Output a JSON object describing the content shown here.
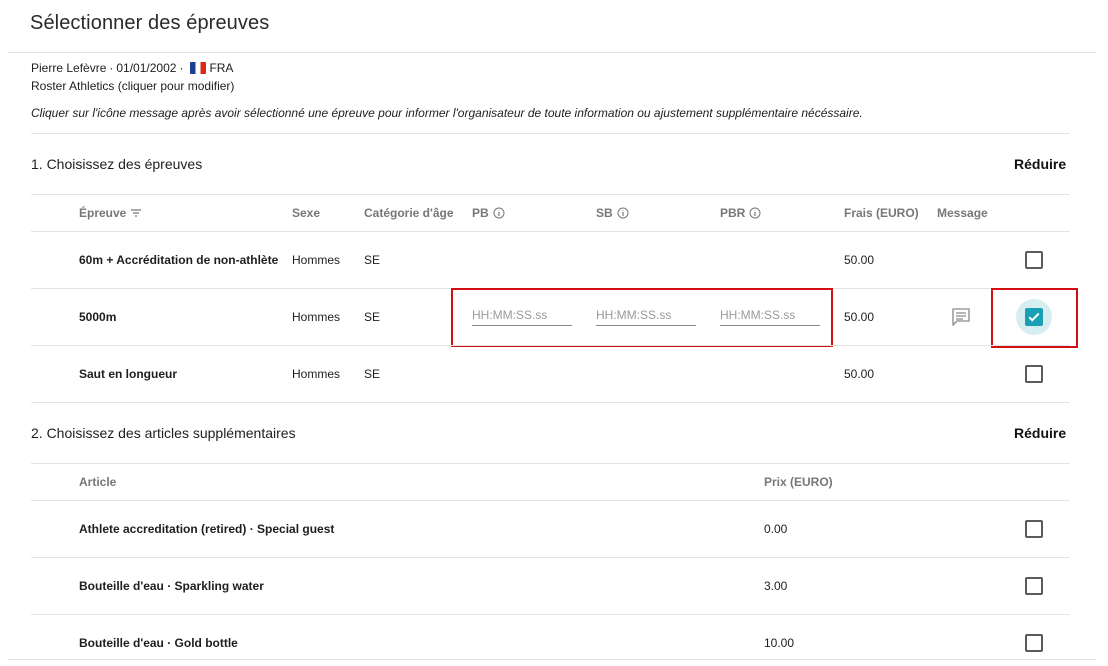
{
  "header": {
    "title": "Sélectionner des épreuves"
  },
  "athlete": {
    "name": "Pierre Lefèvre",
    "dob": "01/01/2002",
    "separator": "·",
    "country": "FRA",
    "club": "Roster Athletics (cliquer pour modifier)"
  },
  "info_text": "Cliquer sur l'icône message après avoir sélectionné une épreuve pour informer l'organisateur de toute information ou ajustement supplémentaire nécéssaire.",
  "events_section": {
    "title": "1. Choisissez des épreuves",
    "collapse_label": "Réduire",
    "columns": {
      "event": "Épreuve",
      "sex": "Sexe",
      "age": "Catégorie d'âge",
      "pb": "PB",
      "sb": "SB",
      "pbr": "PBR",
      "fee": "Frais (EURO)",
      "message": "Message"
    },
    "rows": [
      {
        "event": "60m + Accréditation de non-athlète",
        "sex": "Hommes",
        "age": "SE",
        "fee": "50.00",
        "checked": false
      },
      {
        "event": "5000m",
        "sex": "Hommes",
        "age": "SE",
        "fee": "50.00",
        "checked": true,
        "pb_placeholder": "HH:MM:SS.ss",
        "sb_placeholder": "HH:MM:SS.ss",
        "pbr_placeholder": "HH:MM:SS.ss"
      },
      {
        "event": "Saut en longueur",
        "sex": "Hommes",
        "age": "SE",
        "fee": "50.00",
        "checked": false
      }
    ]
  },
  "items_section": {
    "title": "2. Choisissez des articles supplémentaires",
    "collapse_label": "Réduire",
    "columns": {
      "item": "Article",
      "price": "Prix (EURO)"
    },
    "rows": [
      {
        "item": "Athlete accreditation (retired) · Special guest",
        "price": "0.00",
        "checked": false
      },
      {
        "item": "Bouteille d'eau · Sparkling water",
        "price": "3.00",
        "checked": false
      },
      {
        "item": "Bouteille d'eau · Gold bottle",
        "price": "10.00",
        "checked": false
      }
    ]
  },
  "colors": {
    "accent": "#1aa0b5",
    "highlight": "#d40f14",
    "halo": "#d6eef1"
  },
  "icons": [
    "filter-icon",
    "info-icon",
    "message-icon",
    "checkmark-icon",
    "flag-fr-icon"
  ]
}
